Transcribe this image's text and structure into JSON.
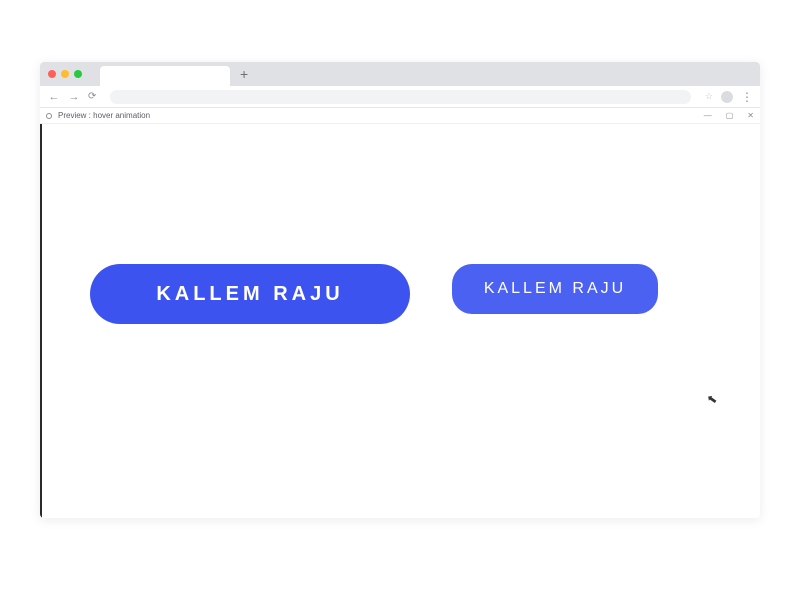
{
  "browser": {
    "new_tab_glyph": "+",
    "nav": {
      "back": "←",
      "forward": "→",
      "reload": "⟳"
    },
    "star": "☆",
    "dots": "⋮"
  },
  "inner_window": {
    "title": "Preview : hover animation",
    "controls": {
      "minimize": "—",
      "maximize": "▢",
      "close": "✕"
    }
  },
  "buttons": {
    "large_label": "KALLEM RAJU",
    "small_label": "KALLEM RAJU"
  },
  "cursor_glyph": "⬉"
}
